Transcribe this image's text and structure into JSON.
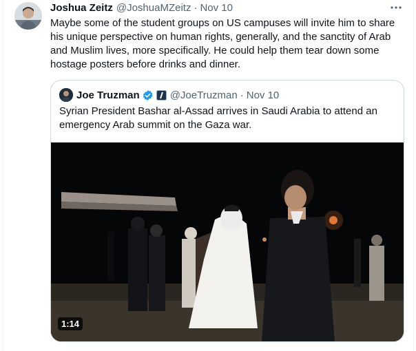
{
  "tweet": {
    "author_name": "Joshua Zeitz",
    "author_handle": "@JoshuaMZeitz",
    "separator": "·",
    "time": "Nov 10",
    "more_icon": "more-horizontal-icon",
    "text": "Maybe some of the student groups on US campuses will invite him to share his unique perspective on human rights, generally, and the sanctity of Arab and Muslim lives, more specifically.  He could help them tear down some hostage posters before drinks and dinner."
  },
  "quote": {
    "author_name": "Joe Truzman",
    "verified_icon": "verified-badge-icon",
    "affiliation_icon": "affiliation-badge-icon",
    "author_handle": "@JoeTruzman",
    "separator": "·",
    "time": "Nov 10",
    "text": "Syrian President Bashar al-Assad arrives in Saudi Arabia to attend an emergency Arab summit on the Gaza war.",
    "video": {
      "duration": "1:14"
    }
  },
  "colors": {
    "text_primary": "#0f1419",
    "text_secondary": "#536471",
    "border": "#cfd9de",
    "verified_blue": "#1d9bf0"
  }
}
